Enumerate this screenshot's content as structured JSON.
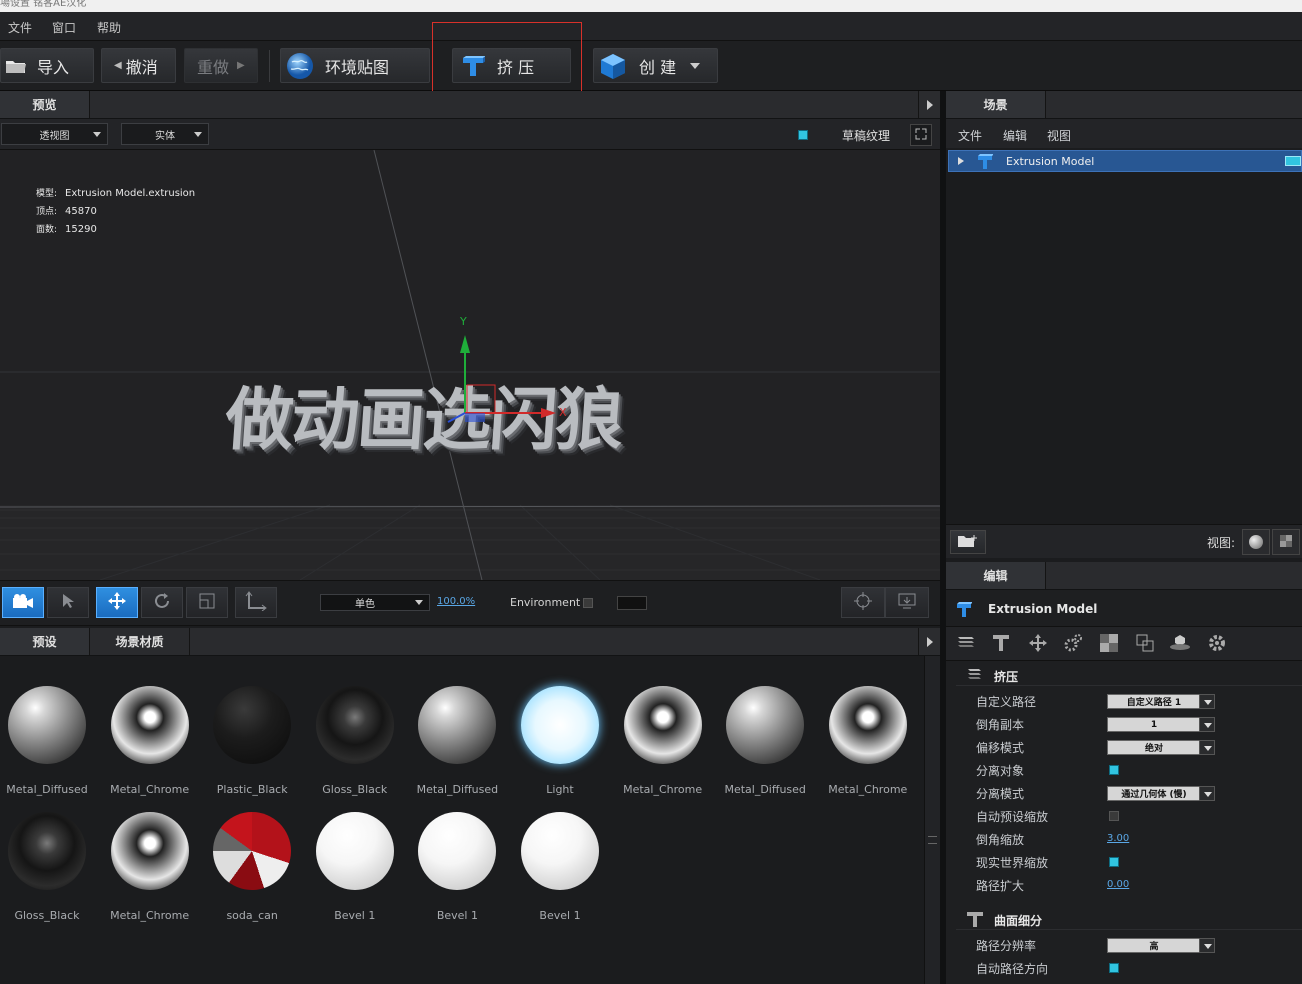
{
  "titlebar": {
    "text": "場设置 铭客AE汉化"
  },
  "menu": {
    "file": "文件",
    "window": "窗口",
    "help": "帮助"
  },
  "toolbar": {
    "import": "导入",
    "undo": "撤消",
    "redo": "重做",
    "env_map": "环境贴图",
    "extrude": "挤 压",
    "create": "创 建"
  },
  "preview": {
    "tab": "预览",
    "view_mode": "透视图",
    "render_mode": "实体",
    "draft_texture": "草稿纹理",
    "info": {
      "model_label": "模型:",
      "model_value": "Extrusion Model.extrusion",
      "verts_label": "顶点:",
      "verts_value": "45870",
      "faces_label": "面数:",
      "faces_value": "15290"
    },
    "headline_text": "做动画选闪狼",
    "axis_y": "Y",
    "axis_x": "X",
    "bottom": {
      "color_mode": "单色",
      "zoom": "100.0%",
      "environment": "Environment"
    }
  },
  "materials": {
    "tabs": [
      "预设",
      "场景材质"
    ],
    "items": [
      {
        "name": "Metal_Diffused",
        "kind": "metal"
      },
      {
        "name": "Metal_Chrome",
        "kind": "chrome"
      },
      {
        "name": "Plastic_Black",
        "kind": "plastic"
      },
      {
        "name": "Gloss_Black",
        "kind": "gloss"
      },
      {
        "name": "Metal_Diffused",
        "kind": "metal"
      },
      {
        "name": "Light",
        "kind": "light"
      },
      {
        "name": "Metal_Chrome",
        "kind": "chrome"
      },
      {
        "name": "Metal_Diffused",
        "kind": "metal"
      },
      {
        "name": "Metal_Chrome",
        "kind": "chrome"
      },
      {
        "name": "Gloss_Black",
        "kind": "gloss"
      },
      {
        "name": "Metal_Chrome",
        "kind": "chrome"
      },
      {
        "name": "soda_can",
        "kind": "soda"
      },
      {
        "name": "Bevel 1",
        "kind": "bevel"
      },
      {
        "name": "Bevel 1",
        "kind": "bevel"
      },
      {
        "name": "Bevel 1",
        "kind": "bevel"
      }
    ]
  },
  "scene": {
    "tab": "场景",
    "menu": [
      "文件",
      "编辑",
      "视图"
    ],
    "item": "Extrusion Model",
    "view_label": "视图:"
  },
  "edit": {
    "tab": "编辑",
    "object": "Extrusion Model",
    "extrude_section": "挤压",
    "props": [
      {
        "label": "自定义路径",
        "type": "select",
        "value": "自定义路径 1"
      },
      {
        "label": "倒角副本",
        "type": "select",
        "value": "1"
      },
      {
        "label": "偏移模式",
        "type": "select",
        "value": "绝对"
      },
      {
        "label": "分离对象",
        "type": "check",
        "value": "on"
      },
      {
        "label": "分离模式",
        "type": "select",
        "value": "通过几何体 (慢)"
      },
      {
        "label": "自动预设缩放",
        "type": "check",
        "value": "off"
      },
      {
        "label": "倒角缩放",
        "type": "link",
        "value": "3.00"
      },
      {
        "label": "现实世界缩放",
        "type": "check",
        "value": "on"
      },
      {
        "label": "路径扩大",
        "type": "link",
        "value": "0.00"
      }
    ],
    "surface_section": "曲面细分",
    "props2": [
      {
        "label": "路径分辨率",
        "type": "select",
        "value": "高"
      },
      {
        "label": "自动路径方向",
        "type": "check",
        "value": "on"
      }
    ]
  }
}
